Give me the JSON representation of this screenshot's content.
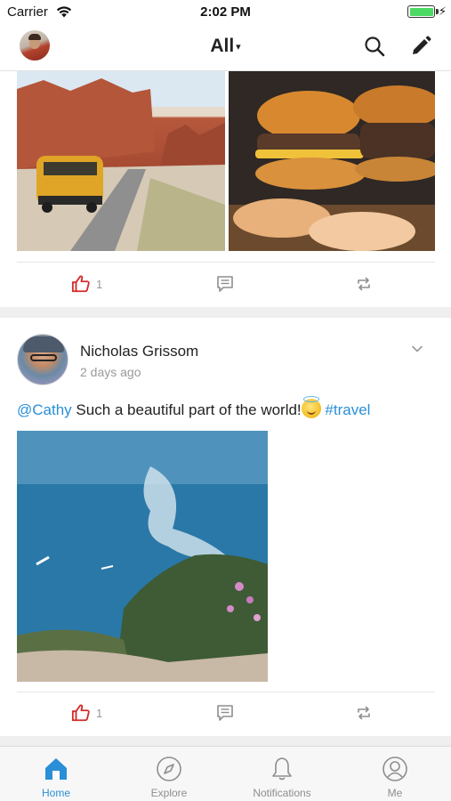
{
  "status_bar": {
    "carrier": "Carrier",
    "time": "2:02 PM"
  },
  "nav": {
    "title": "All",
    "caret": "▾"
  },
  "feed": {
    "posts": [
      {
        "likes": "1"
      },
      {
        "author": "Nicholas Grissom",
        "time": "2 days ago",
        "mention": "@Cathy",
        "text": " Such a beautiful part of the world!",
        "hashtag": "#travel",
        "likes": "1"
      }
    ]
  },
  "tabs": [
    {
      "label": "Home",
      "icon": "home-icon",
      "active": true
    },
    {
      "label": "Explore",
      "icon": "compass-icon",
      "active": false
    },
    {
      "label": "Notifications",
      "icon": "bell-icon",
      "active": false
    },
    {
      "label": "Me",
      "icon": "profile-icon",
      "active": false
    }
  ],
  "colors": {
    "accent": "#2a8fd6",
    "like": "#d22b2b",
    "icon_gray": "#8e8e8e"
  }
}
